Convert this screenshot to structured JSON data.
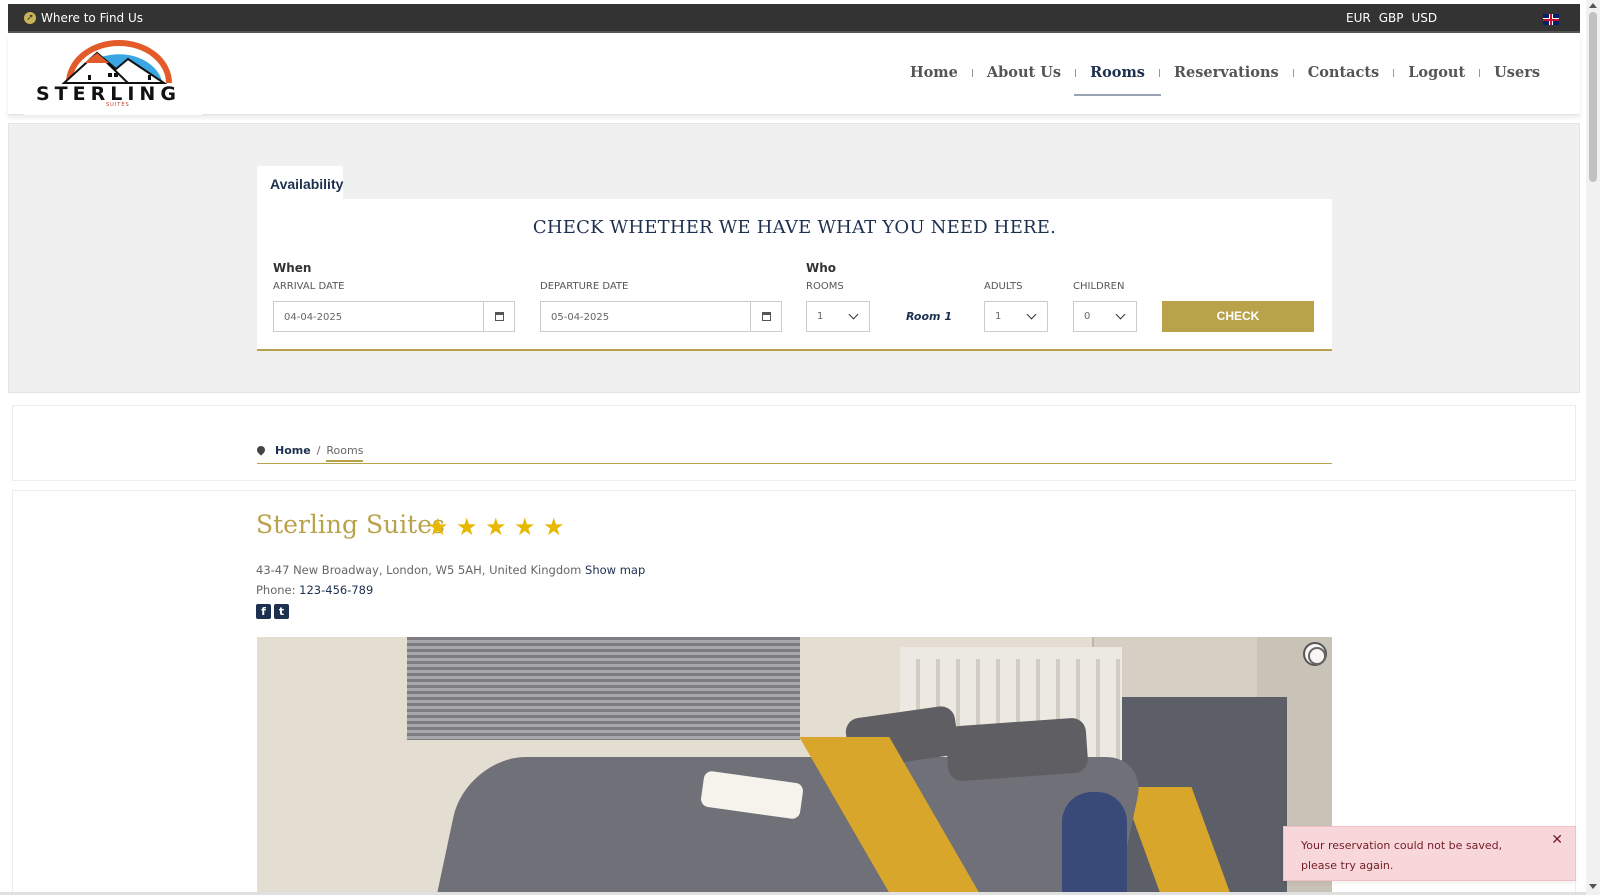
{
  "topbar": {
    "find_label": "Where to Find Us",
    "currencies": [
      "EUR",
      "GBP",
      "USD"
    ]
  },
  "logo": {
    "word": "STERLING",
    "sub": "SUITES"
  },
  "nav": {
    "items": [
      "Home",
      "About Us",
      "Rooms",
      "Reservations",
      "Contacts",
      "Logout",
      "Users"
    ],
    "active": "Rooms"
  },
  "availability": {
    "tab_label": "Availability",
    "title": "CHECK WHETHER WE HAVE WHAT YOU NEED HERE.",
    "when_label": "When",
    "arrival_label": "ARRIVAL DATE",
    "arrival_value": "04-04-2025",
    "departure_label": "DEPARTURE DATE",
    "departure_value": "05-04-2025",
    "who_label": "Who",
    "rooms_label": "ROOMS",
    "rooms_value": "1",
    "room_name": "Room 1",
    "adults_label": "ADULTS",
    "adults_value": "1",
    "children_label": "CHILDREN",
    "children_value": "0",
    "check_label": "CHECK"
  },
  "breadcrumb": {
    "home": "Home",
    "separator": "/",
    "current": "Rooms"
  },
  "hotel": {
    "name": "Sterling Suites",
    "stars": 5,
    "address": "43-47 New Broadway, London, W5 5AH, United Kingdom",
    "show_map": "Show map",
    "phone_label": "Phone:",
    "phone_number": "123-456-789"
  },
  "toast": {
    "message": "Your reservation could not be saved, please try again."
  },
  "colors": {
    "accent": "#b8a24a",
    "navy": "#1e3050",
    "topbar": "#333333",
    "toast_bg": "#f8d7da",
    "star": "#e6b800"
  },
  "icons": [
    "compass-icon",
    "uk-flag-icon",
    "calendar-icon",
    "chevron-down-icon",
    "map-pin-icon",
    "star-icon",
    "facebook-icon",
    "twitter-icon",
    "close-icon",
    "slideshow-control-icon"
  ]
}
